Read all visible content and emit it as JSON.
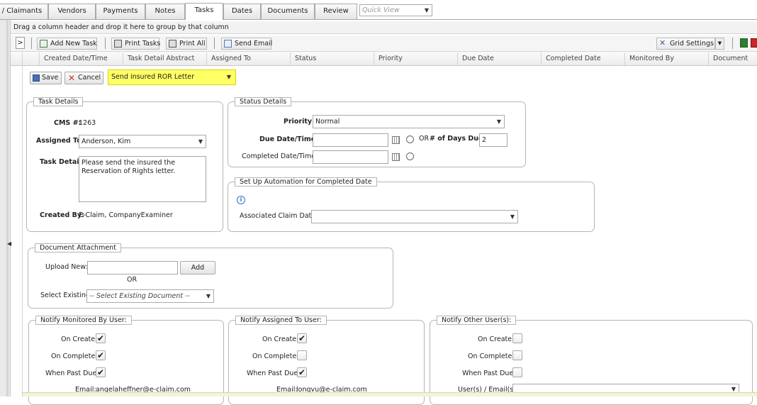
{
  "tabs": [
    {
      "label": "/ Claimants"
    },
    {
      "label": "Vendors"
    },
    {
      "label": "Payments"
    },
    {
      "label": "Notes"
    },
    {
      "label": "Tasks"
    },
    {
      "label": "Dates"
    },
    {
      "label": "Documents"
    },
    {
      "label": "Review"
    }
  ],
  "quick_view": {
    "placeholder": "Quick View"
  },
  "group_hint": "Drag a column header and drop it here to group by that column",
  "toolbar": {
    "expand": ">",
    "add_new_task": "Add New Task",
    "print_tasks": "Print Tasks",
    "print_all": "Print All",
    "send_email": "Send Email",
    "grid_settings": "Grid Settings"
  },
  "columns": [
    "Created Date/Time",
    "Task Detail Abstract",
    "Assigned To",
    "Status",
    "Priority",
    "Due Date",
    "Completed Date",
    "Monitored By",
    "Document"
  ],
  "form": {
    "save": "Save",
    "cancel": "Cancel",
    "task_template": "Send insured ROR Letter"
  },
  "task_details": {
    "legend": "Task Details",
    "cms_label": "CMS #:",
    "cms_value": "1263",
    "assigned_to_label": "Assigned To:",
    "assigned_to_value": "Anderson, Kim",
    "task_detail_label": "Task Detail:",
    "task_detail_value": "Please send the insured the Reservation of Rights letter.",
    "created_by_label": "Created By:",
    "created_by_value": "E-Claim, CompanyExaminer"
  },
  "status_details": {
    "legend": "Status Details",
    "priority_label": "Priority:",
    "priority_value": "Normal",
    "due_label": "Due Date/Time:",
    "or_label": "OR",
    "days_due_label": "# of Days Due:",
    "days_due_value": "2",
    "completed_label": "Completed Date/Time:"
  },
  "automation": {
    "legend": "Set Up Automation for Completed Date",
    "associated_label": "Associated Claim Date:"
  },
  "attachment": {
    "legend": "Document Attachment",
    "upload_label": "Upload New:",
    "add_button": "Add",
    "or_label": "OR",
    "select_label": "Select Existing:",
    "select_value": "-- Select Existing Document --"
  },
  "notify_monitored": {
    "legend": "Notify Monitored By User:",
    "on_create": "On Create:",
    "on_complete": "On Complete:",
    "past_due": "When Past Due:",
    "email_label": "Email:",
    "email_value": "angelaheffner@e-claim.com",
    "checks": {
      "on_create": "✔",
      "on_complete": "✔",
      "past_due": "✔"
    }
  },
  "notify_assigned": {
    "legend": "Notify Assigned To User:",
    "on_create": "On Create:",
    "on_complete": "On Complete:",
    "past_due": "When Past Due:",
    "email_label": "Email:",
    "email_value": "longvu@e-claim.com",
    "checks": {
      "on_create": "✔",
      "on_complete": "",
      "past_due": "✔"
    }
  },
  "notify_other": {
    "legend": "Notify Other User(s):",
    "on_create": "On Create:",
    "on_complete": "On Complete:",
    "past_due": "When Past Due:",
    "users_label": "User(s) / Email(s):"
  },
  "colors": {
    "highlight": "#ffff66",
    "info_icon": "#3a6fc4"
  }
}
